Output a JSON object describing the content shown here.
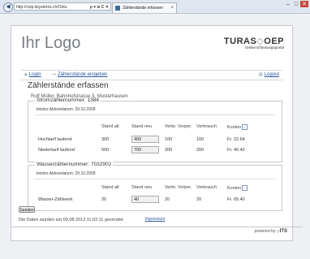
{
  "browser": {
    "url": "http://cwp.itsystems.ch/Oelu",
    "address_controls": "ρ ▾ ≌ C ✕",
    "tab_title": "Zählerstände erfassen",
    "tab_close": "×",
    "window_controls": [
      "–",
      "□",
      "✕"
    ]
  },
  "header": {
    "logo": "Ihr Logo",
    "brand_name_prefix": "TURAS",
    "brand_name_suffix": "OEP",
    "brand_sub": "Online Erfassungsportal"
  },
  "nav": {
    "login": "Login",
    "zahlerstaende": "Zählerstände eingeben",
    "logout": "Logout"
  },
  "page_title": "Zählerstände erfassen",
  "customer": "Rolf Müller, Bahnhofstrasse 3, Musterhausen",
  "meters": [
    {
      "legend": "Stromzählernummer: 1384",
      "last_reading": "letztes Ablesedatum: 29.10.2009",
      "headers": [
        "Stand alt",
        "Stand neu",
        "Verbr. Vorper.",
        "Verbrauch",
        "Kosten"
      ],
      "rows": [
        {
          "label": "Hochtarif laufend",
          "alt": "300",
          "neu": "400",
          "vorper": "100",
          "verbrauch": "100",
          "kosten": "Fr. 22.64"
        },
        {
          "label": "Niedertarif laufend",
          "alt": "500",
          "neu": "700",
          "vorper": "200",
          "verbrauch": "200",
          "kosten": "Fr. 40.42"
        }
      ]
    },
    {
      "legend": "Wasserzählernummer: 7032902",
      "last_reading": "letztes Ablesedatum: 29.10.2009",
      "headers": [
        "Stand alt",
        "Stand neu",
        "Verbr. Vorper.",
        "Verbrauch",
        "Kosten"
      ],
      "rows": [
        {
          "label": "Wasser-Zählwerk",
          "alt": "20",
          "neu": "40",
          "vorper": "20",
          "verbrauch": "20",
          "kosten": "Fr. 65.40"
        }
      ]
    }
  ],
  "send_button": "Senden",
  "sent_message": "Die Daten wurden am 09.08.2012 11:02:11 gesendet",
  "powered_by": "powered by",
  "powered_brand": "ITS",
  "impressum": "Impressum"
}
